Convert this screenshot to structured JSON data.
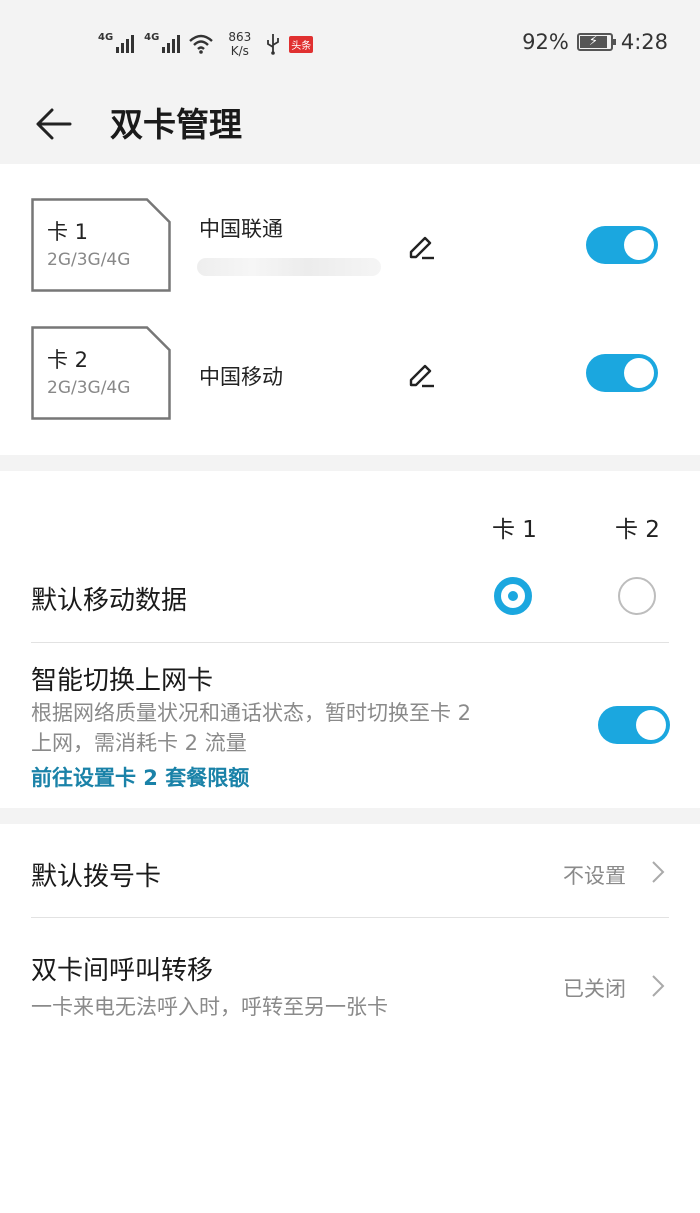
{
  "status_bar": {
    "signal1_label": "4G",
    "signal2_label": "4G",
    "speed_value": "863",
    "speed_unit": "K/s",
    "toutiao_badge": "头条",
    "battery": "92%",
    "battery_level": 0.92,
    "time": "4:28"
  },
  "header": {
    "title": "双卡管理"
  },
  "sims": [
    {
      "name": "卡 1",
      "network": "2G/3G/4G",
      "carrier": "中国联通",
      "enabled": true
    },
    {
      "name": "卡 2",
      "network": "2G/3G/4G",
      "carrier": "中国移动",
      "enabled": true
    }
  ],
  "data_section": {
    "col_card1": "卡 1",
    "col_card2": "卡 2",
    "default_data_label": "默认移动数据",
    "default_data_selected": "卡 1",
    "smart_switch": {
      "title": "智能切换上网卡",
      "desc_line1": "根据网络质量状况和通话状态，暂时切换至卡 2",
      "desc_line2": "上网，需消耗卡 2 流量",
      "link": "前往设置卡 2 套餐限额",
      "enabled": true
    }
  },
  "call_section": {
    "default_dial": {
      "label": "默认拨号卡",
      "value": "不设置"
    },
    "call_forward": {
      "label": "双卡间呼叫转移",
      "desc": "一卡来电无法呼入时，呼转至另一张卡",
      "value": "已关闭"
    }
  },
  "colors": {
    "accent": "#1ba7df",
    "link": "#1a82a8",
    "background_gray": "#f3f3f3"
  }
}
